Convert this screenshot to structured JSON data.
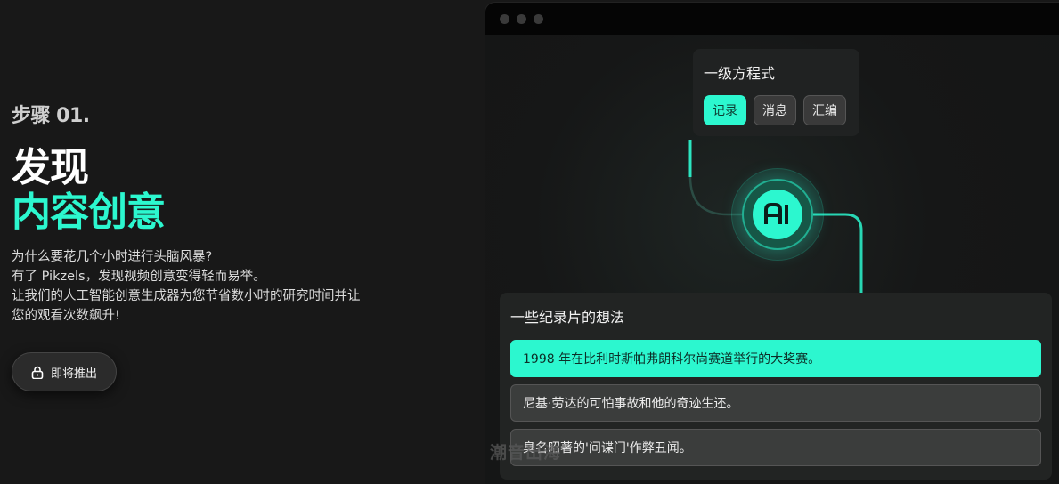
{
  "hero": {
    "step": "步骤 01.",
    "title_line1": "发现",
    "title_line2": "内容创意",
    "desc_line1": "为什么要花几个小时进行头脑风暴?",
    "desc_line2": "有了 Pikzels，发现视频创意变得轻而易举。",
    "desc_line3": "让我们的人工智能创意生成器为您节省数小时的研究时间并让",
    "desc_line4": "您的观看次数飙升!",
    "button_label": "即将推出",
    "button_icon": "lock-icon"
  },
  "window": {
    "equation_card": {
      "title": "一级方程式",
      "chips": [
        {
          "label": "记录",
          "active": true
        },
        {
          "label": "消息",
          "active": false
        },
        {
          "label": "汇编",
          "active": false
        }
      ]
    },
    "ai_badge": {
      "label": "AI",
      "icon": "ai-logo-icon"
    },
    "ideas_card": {
      "title": "一些纪录片的想法",
      "items": [
        {
          "text": "1998 年在比利时斯帕弗朗科尔尚赛道举行的大奖赛。",
          "active": true
        },
        {
          "text": "尼基·劳达的可怕事故和他的奇迹生还。",
          "active": false
        },
        {
          "text": "臭名昭著的'间谍门'作弊丑闻。",
          "active": false
        }
      ]
    }
  },
  "watermark": "潮音出海",
  "colors": {
    "accent": "#2cf7cf",
    "background": "#181818",
    "card": "#222423"
  }
}
